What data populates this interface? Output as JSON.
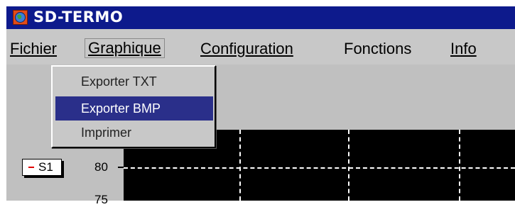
{
  "window": {
    "title": "SD-TERMO",
    "icon": "globe-icon"
  },
  "menubar": {
    "items": [
      {
        "label": "Fichier"
      },
      {
        "label": "Graphique"
      },
      {
        "label": "Configuration"
      },
      {
        "label": "Fonctions"
      },
      {
        "label": "Info"
      }
    ]
  },
  "dropdown": {
    "items": [
      {
        "label": "Exporter TXT"
      },
      {
        "label": "Exporter BMP",
        "highlighted": true
      },
      {
        "label": "Imprimer"
      }
    ]
  },
  "chart": {
    "yticks": [
      "80",
      "75"
    ],
    "legend": {
      "label": "S1",
      "color": "#e00000"
    }
  },
  "colors": {
    "titlebar": "#0d1a8c",
    "highlight": "#2a2f8a",
    "chart_bg": "#000000"
  }
}
